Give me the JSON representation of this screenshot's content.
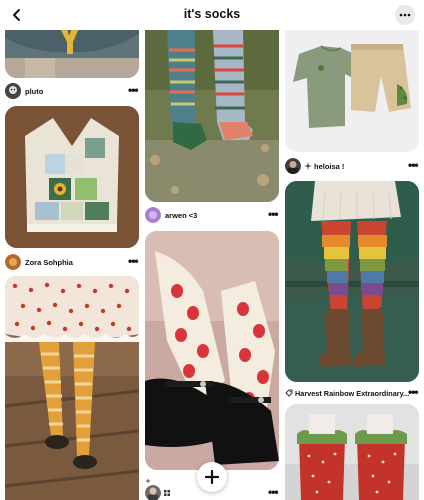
{
  "header": {
    "title": "it's socks",
    "back_icon": "chevron-left-icon",
    "more_icon": "more-horizontal-icon"
  },
  "pins": {
    "col1": [
      {
        "username": "pluto"
      },
      {
        "username": "Zora Sohphia"
      }
    ],
    "col2": [
      {
        "username": "arwen <3"
      },
      {
        "username": ""
      }
    ],
    "col3": [
      {
        "username": "heloisa !",
        "prefix_icon": "sparkle-icon"
      },
      {
        "username": "Harvest Rainbow Extraordinary...",
        "prefix_icon": "pin-icon"
      }
    ]
  },
  "more_label": "•••",
  "fab": {
    "icon": "plus-icon"
  },
  "colors": {
    "background": "#ffffff",
    "text": "#111111",
    "more_button_bg": "#e9e9e9"
  }
}
